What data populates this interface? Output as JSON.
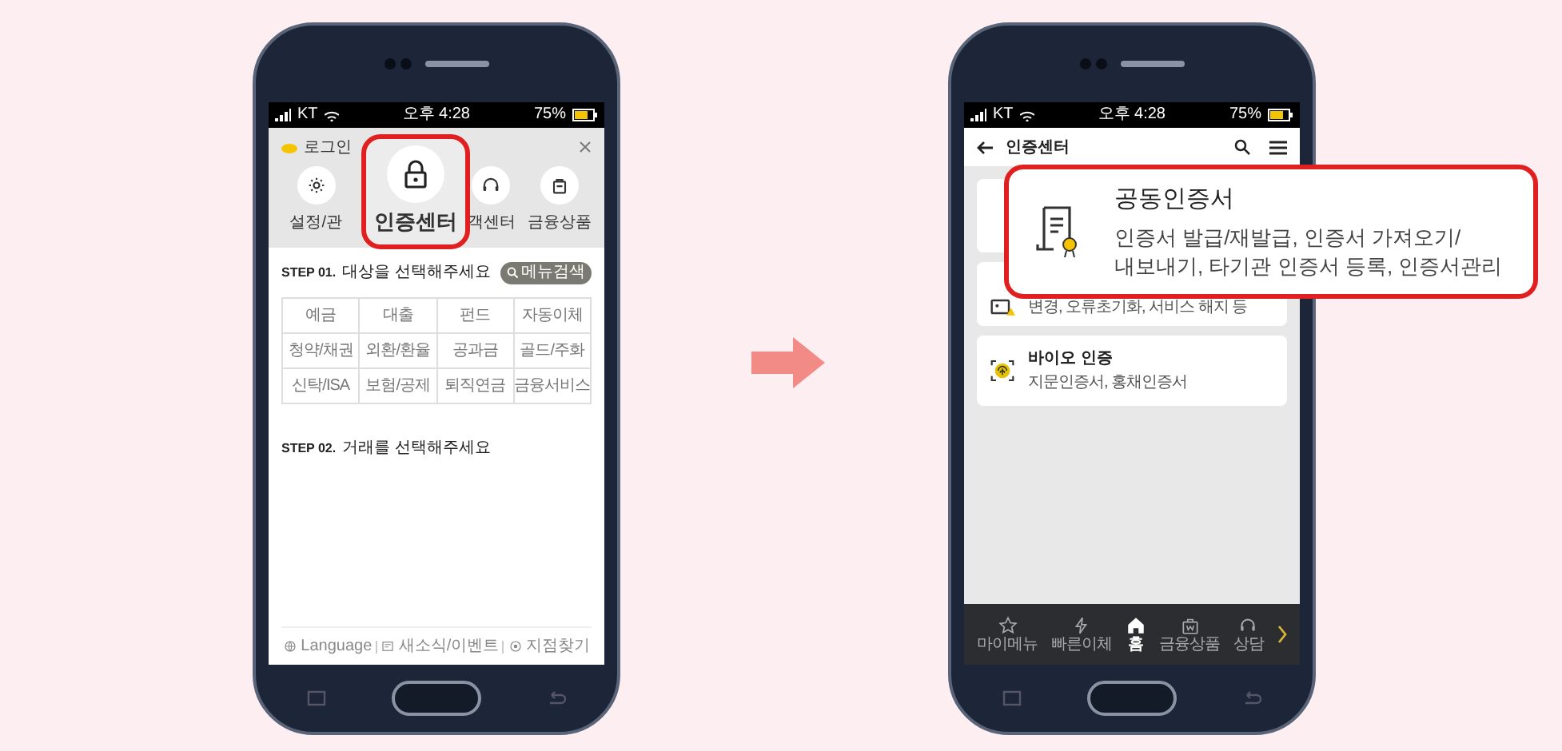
{
  "left_phone": {
    "status_bar": {
      "carrier": "KT",
      "time": "오후 4:28",
      "battery": "75%"
    },
    "header": {
      "login": "로그인"
    },
    "quick_menu": [
      {
        "label": "설정/관"
      },
      {
        "label": "객센터"
      },
      {
        "label": "금융상품"
      }
    ],
    "highlight": {
      "label": "인증센터"
    },
    "step1": {
      "step": "STEP 01.",
      "text": "대상을 선택해주세요",
      "search_button": "메뉴검색"
    },
    "categories": [
      "예금",
      "대출",
      "펀드",
      "자동이체",
      "청약/채권",
      "외환/환율",
      "공과금",
      "골드/주화",
      "신탁/ISA",
      "보험/공제",
      "퇴직연금",
      "금융서비스"
    ],
    "step2": {
      "step": "STEP 02.",
      "text": "거래를 선택해주세요"
    },
    "footer": [
      {
        "label": "Language"
      },
      {
        "label": "새소식/이벤트"
      },
      {
        "label": "지점찾기"
      }
    ]
  },
  "right_phone": {
    "status_bar": {
      "carrier": "KT",
      "time": "오후 4:28",
      "battery": "75%"
    },
    "header": {
      "title": "인증센터"
    },
    "cards": [
      {
        "kind": "covered"
      },
      {
        "kind": "partial",
        "subtitle": "변경, 오류초기화, 서비스 해지 등"
      },
      {
        "kind": "full",
        "title": "바이오 인증",
        "subtitle": "지문인증서, 홍채인증서"
      }
    ],
    "nav": [
      {
        "label": "마이메뉴",
        "selected": false
      },
      {
        "label": "빠른이체",
        "selected": false
      },
      {
        "label": "홈",
        "selected": true
      },
      {
        "label": "금융상품",
        "selected": false
      },
      {
        "label": "상담",
        "selected": false
      }
    ],
    "callout": {
      "title": "공동인증서",
      "lines": [
        "인증서 발급/재발급, 인증서 가져오기/",
        "내보내기, 타기관 인증서 등록, 인증서관리"
      ]
    }
  }
}
